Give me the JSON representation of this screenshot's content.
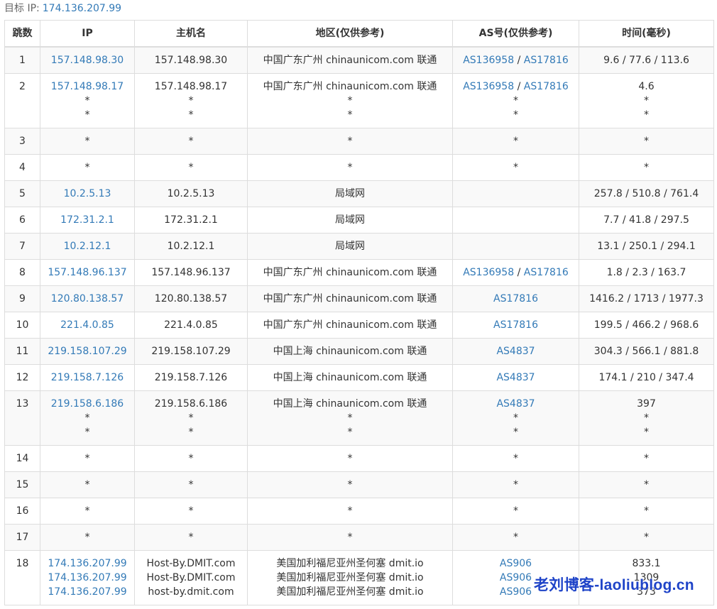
{
  "target": {
    "label": "目标 IP:",
    "ip": "174.136.207.99"
  },
  "table": {
    "headers": [
      "跳数",
      "IP",
      "主机名",
      "地区(仅供参考)",
      "AS号(仅供参考)",
      "时间(毫秒)"
    ],
    "rows": [
      {
        "hop": "1",
        "ip": [
          "157.148.98.30"
        ],
        "host": [
          "157.148.98.30"
        ],
        "region": [
          "中国广东广州 chinaunicom.com 联通"
        ],
        "as": [
          [
            "AS136958",
            "AS17816"
          ]
        ],
        "time": [
          "9.6 / 77.6 / 113.6"
        ]
      },
      {
        "hop": "2",
        "ip": [
          "157.148.98.17",
          "*",
          "*"
        ],
        "host": [
          "157.148.98.17",
          "*",
          "*"
        ],
        "region": [
          "中国广东广州 chinaunicom.com 联通",
          "*",
          "*"
        ],
        "as": [
          [
            "AS136958",
            "AS17816"
          ],
          [
            "*"
          ],
          [
            "*"
          ]
        ],
        "time": [
          "4.6",
          "*",
          "*"
        ]
      },
      {
        "hop": "3",
        "ip": [
          "*"
        ],
        "host": [
          "*"
        ],
        "region": [
          "*"
        ],
        "as": [
          [
            "*"
          ]
        ],
        "time": [
          "*"
        ]
      },
      {
        "hop": "4",
        "ip": [
          "*"
        ],
        "host": [
          "*"
        ],
        "region": [
          "*"
        ],
        "as": [
          [
            "*"
          ]
        ],
        "time": [
          "*"
        ]
      },
      {
        "hop": "5",
        "ip": [
          "10.2.5.13"
        ],
        "host": [
          "10.2.5.13"
        ],
        "region": [
          "局域网"
        ],
        "as": [
          []
        ],
        "time": [
          "257.8 / 510.8 / 761.4"
        ]
      },
      {
        "hop": "6",
        "ip": [
          "172.31.2.1"
        ],
        "host": [
          "172.31.2.1"
        ],
        "region": [
          "局域网"
        ],
        "as": [
          []
        ],
        "time": [
          "7.7 / 41.8 / 297.5"
        ]
      },
      {
        "hop": "7",
        "ip": [
          "10.2.12.1"
        ],
        "host": [
          "10.2.12.1"
        ],
        "region": [
          "局域网"
        ],
        "as": [
          []
        ],
        "time": [
          "13.1 / 250.1 / 294.1"
        ]
      },
      {
        "hop": "8",
        "ip": [
          "157.148.96.137"
        ],
        "host": [
          "157.148.96.137"
        ],
        "region": [
          "中国广东广州 chinaunicom.com 联通"
        ],
        "as": [
          [
            "AS136958",
            "AS17816"
          ]
        ],
        "time": [
          "1.8 / 2.3 / 163.7"
        ]
      },
      {
        "hop": "9",
        "ip": [
          "120.80.138.57"
        ],
        "host": [
          "120.80.138.57"
        ],
        "region": [
          "中国广东广州 chinaunicom.com 联通"
        ],
        "as": [
          [
            "AS17816"
          ]
        ],
        "time": [
          "1416.2 / 1713 / 1977.3"
        ]
      },
      {
        "hop": "10",
        "ip": [
          "221.4.0.85"
        ],
        "host": [
          "221.4.0.85"
        ],
        "region": [
          "中国广东广州 chinaunicom.com 联通"
        ],
        "as": [
          [
            "AS17816"
          ]
        ],
        "time": [
          "199.5 / 466.2 / 968.6"
        ]
      },
      {
        "hop": "11",
        "ip": [
          "219.158.107.29"
        ],
        "host": [
          "219.158.107.29"
        ],
        "region": [
          "中国上海 chinaunicom.com 联通"
        ],
        "as": [
          [
            "AS4837"
          ]
        ],
        "time": [
          "304.3 / 566.1 / 881.8"
        ]
      },
      {
        "hop": "12",
        "ip": [
          "219.158.7.126"
        ],
        "host": [
          "219.158.7.126"
        ],
        "region": [
          "中国上海 chinaunicom.com 联通"
        ],
        "as": [
          [
            "AS4837"
          ]
        ],
        "time": [
          "174.1 / 210 / 347.4"
        ]
      },
      {
        "hop": "13",
        "ip": [
          "219.158.6.186",
          "*",
          "*"
        ],
        "host": [
          "219.158.6.186",
          "*",
          "*"
        ],
        "region": [
          "中国上海 chinaunicom.com 联通",
          "*",
          "*"
        ],
        "as": [
          [
            "AS4837"
          ],
          [
            "*"
          ],
          [
            "*"
          ]
        ],
        "time": [
          "397",
          "*",
          "*"
        ]
      },
      {
        "hop": "14",
        "ip": [
          "*"
        ],
        "host": [
          "*"
        ],
        "region": [
          "*"
        ],
        "as": [
          [
            "*"
          ]
        ],
        "time": [
          "*"
        ]
      },
      {
        "hop": "15",
        "ip": [
          "*"
        ],
        "host": [
          "*"
        ],
        "region": [
          "*"
        ],
        "as": [
          [
            "*"
          ]
        ],
        "time": [
          "*"
        ]
      },
      {
        "hop": "16",
        "ip": [
          "*"
        ],
        "host": [
          "*"
        ],
        "region": [
          "*"
        ],
        "as": [
          [
            "*"
          ]
        ],
        "time": [
          "*"
        ]
      },
      {
        "hop": "17",
        "ip": [
          "*"
        ],
        "host": [
          "*"
        ],
        "region": [
          "*"
        ],
        "as": [
          [
            "*"
          ]
        ],
        "time": [
          "*"
        ]
      },
      {
        "hop": "18",
        "ip": [
          "174.136.207.99",
          "174.136.207.99",
          "174.136.207.99"
        ],
        "host": [
          "Host-By.DMIT.com",
          "Host-By.DMIT.com",
          "host-by.dmit.com"
        ],
        "region": [
          "美国加利福尼亚州圣何塞 dmit.io",
          "美国加利福尼亚州圣何塞 dmit.io",
          "美国加利福尼亚州圣何塞 dmit.io"
        ],
        "as": [
          [
            "AS906"
          ],
          [
            "AS906"
          ],
          [
            "AS906"
          ]
        ],
        "time": [
          "833.1",
          "1309",
          "373"
        ]
      }
    ]
  },
  "watermark": "老刘博客-laoliublog.cn",
  "colors": {
    "link": "#337ab7",
    "border": "#dddddd",
    "stripe": "#f9f9f9",
    "watermark": "#1f44c8"
  }
}
